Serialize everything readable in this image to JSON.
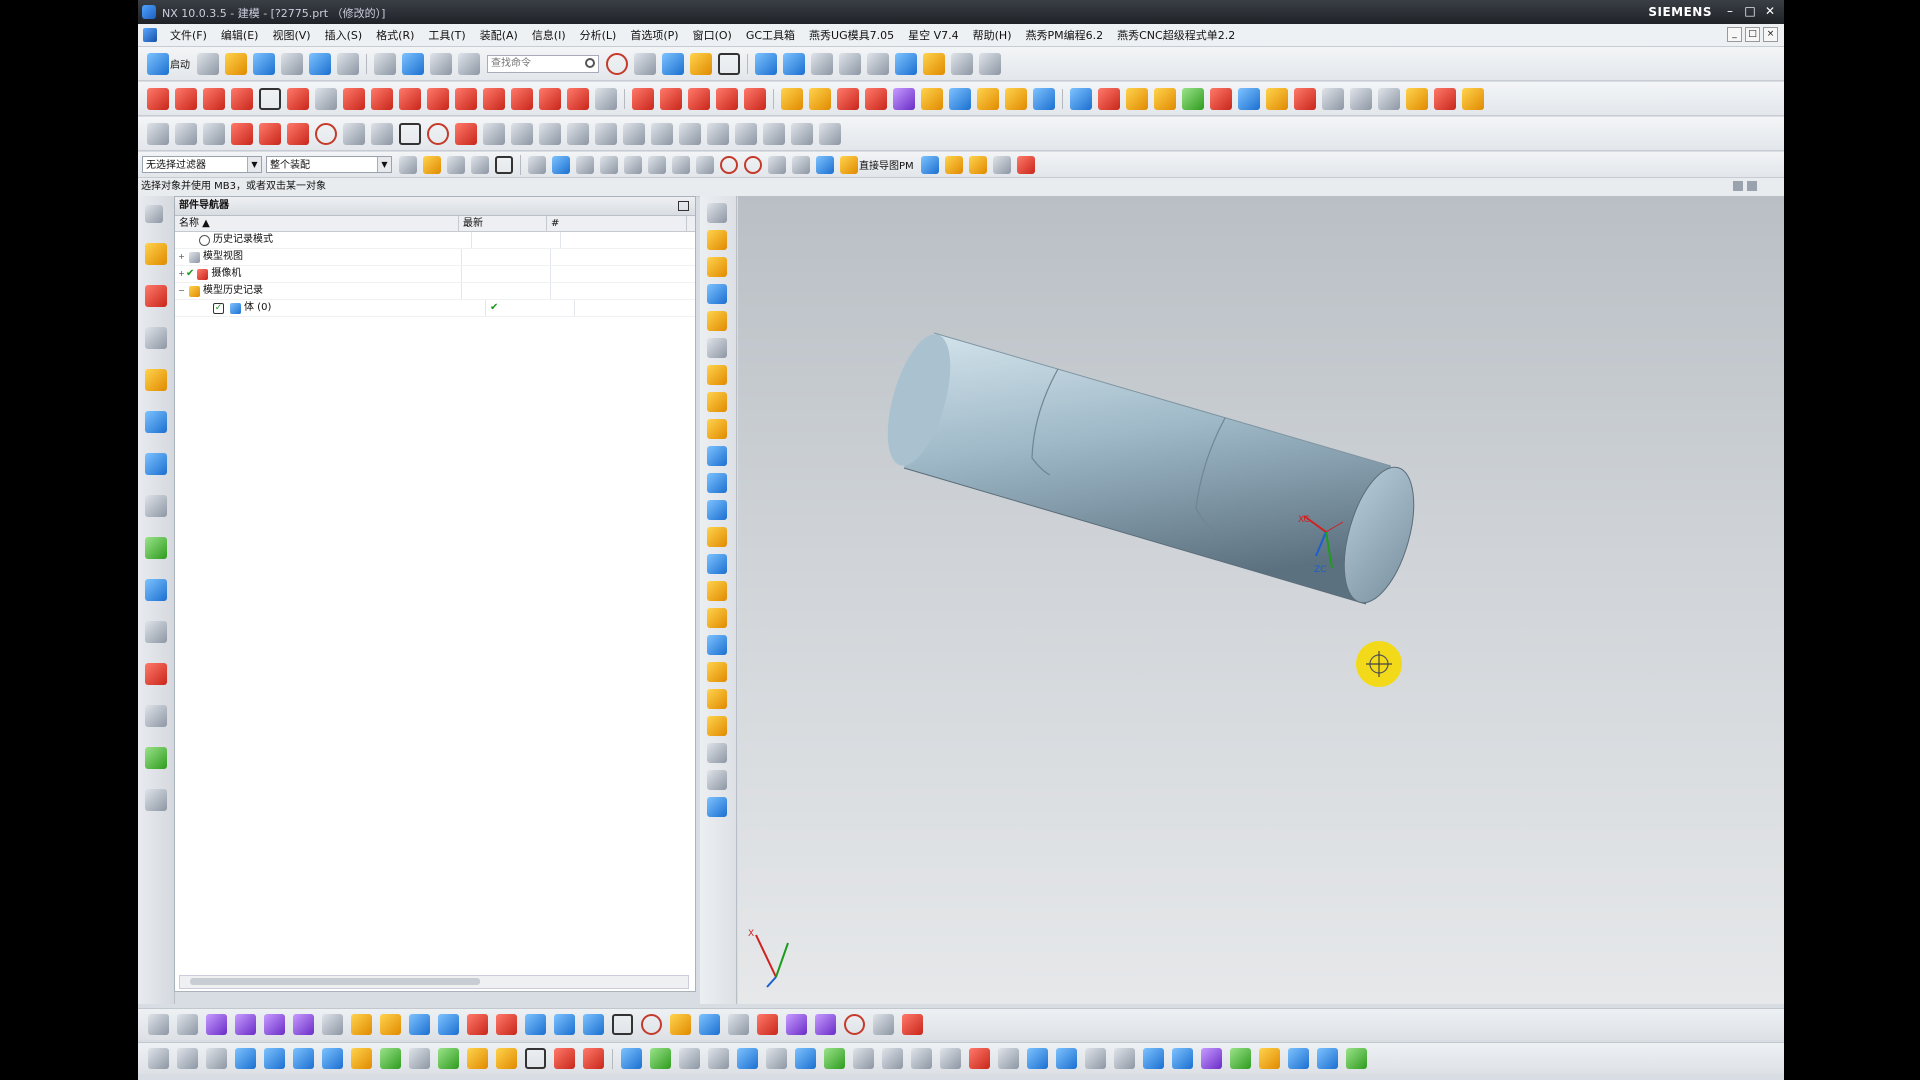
{
  "window": {
    "title": "NX 10.0.3.5 - 建模 - [?2775.prt （修改的）]",
    "brand": "SIEMENS",
    "controls": [
      "–",
      "□",
      "✕"
    ]
  },
  "menu": {
    "items": [
      "文件(F)",
      "编辑(E)",
      "视图(V)",
      "插入(S)",
      "格式(R)",
      "工具(T)",
      "装配(A)",
      "信息(I)",
      "分析(L)",
      "首选项(P)",
      "窗口(O)",
      "GC工具箱",
      "燕秀UG模具7.05",
      "星空 V7.4",
      "帮助(H)",
      "燕秀PM编程6.2",
      "燕秀CNC超级程式单2.2"
    ]
  },
  "toolbar_top": {
    "start_label": "启动",
    "search_placeholder": "查找命令"
  },
  "toolbar_filter": {
    "selection_filter": "无选择过滤器",
    "assembly_scope": "整个装配",
    "direct_pm_label": "直接导图PM"
  },
  "statusline": {
    "prompt": "选择对象并使用 MB3，或者双击某一对象"
  },
  "part_navigator": {
    "title": "部件导航器",
    "columns": [
      "名称",
      "最新",
      "#"
    ],
    "rows": [
      {
        "label": "历史记录模式",
        "expander": "",
        "latest": ""
      },
      {
        "label": "模型视图",
        "expander": "+",
        "latest": ""
      },
      {
        "label": "摄像机",
        "expander": "+",
        "latest": ""
      },
      {
        "label": "模型历史记录",
        "expander": "−",
        "latest": ""
      },
      {
        "label": "体 (0)",
        "expander": "",
        "latest": "✔"
      }
    ]
  },
  "viewport": {
    "csys_labels": [
      "XC",
      "ZC"
    ],
    "triad_label": "X"
  },
  "colors": {
    "accent": "#1b6fd0",
    "cylinder": "#a6c4d3",
    "cursor": "#f2da1a"
  }
}
